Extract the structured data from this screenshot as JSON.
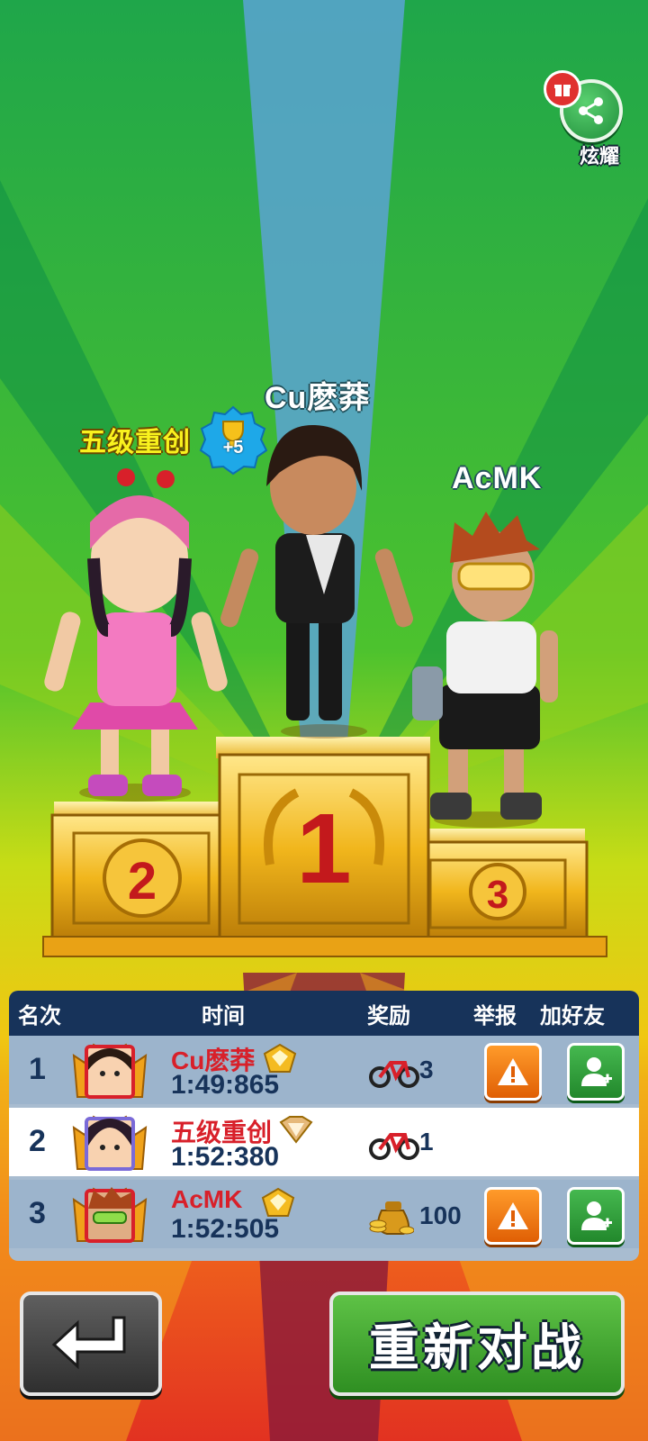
{
  "share": {
    "label": "炫耀"
  },
  "podium": {
    "first_name": "Cu麽莽",
    "second_name": "五级重创",
    "third_name": "AcMK",
    "trophy_bonus": "+5"
  },
  "table": {
    "headers": {
      "rank": "名次",
      "time": "时间",
      "reward": "奖励",
      "report": "举报",
      "add_friend": "加好友"
    },
    "rows": [
      {
        "rank": "1",
        "name": "Cu麽莽",
        "time": "1:49:865",
        "reward_value": "3",
        "reward_type": "bike-icon"
      },
      {
        "rank": "2",
        "name": "五级重创",
        "time": "1:52:380",
        "reward_value": "1",
        "reward_type": "bike-icon"
      },
      {
        "rank": "3",
        "name": "AcMK",
        "time": "1:52:505",
        "reward_value": "100",
        "reward_type": "coin-bag-icon"
      }
    ]
  },
  "buttons": {
    "rematch": "重新对战"
  },
  "colors": {
    "name_red": "#d8202a",
    "header_navy": "#17335a",
    "report_orange": "#f07b12",
    "friend_green": "#33a13c"
  }
}
